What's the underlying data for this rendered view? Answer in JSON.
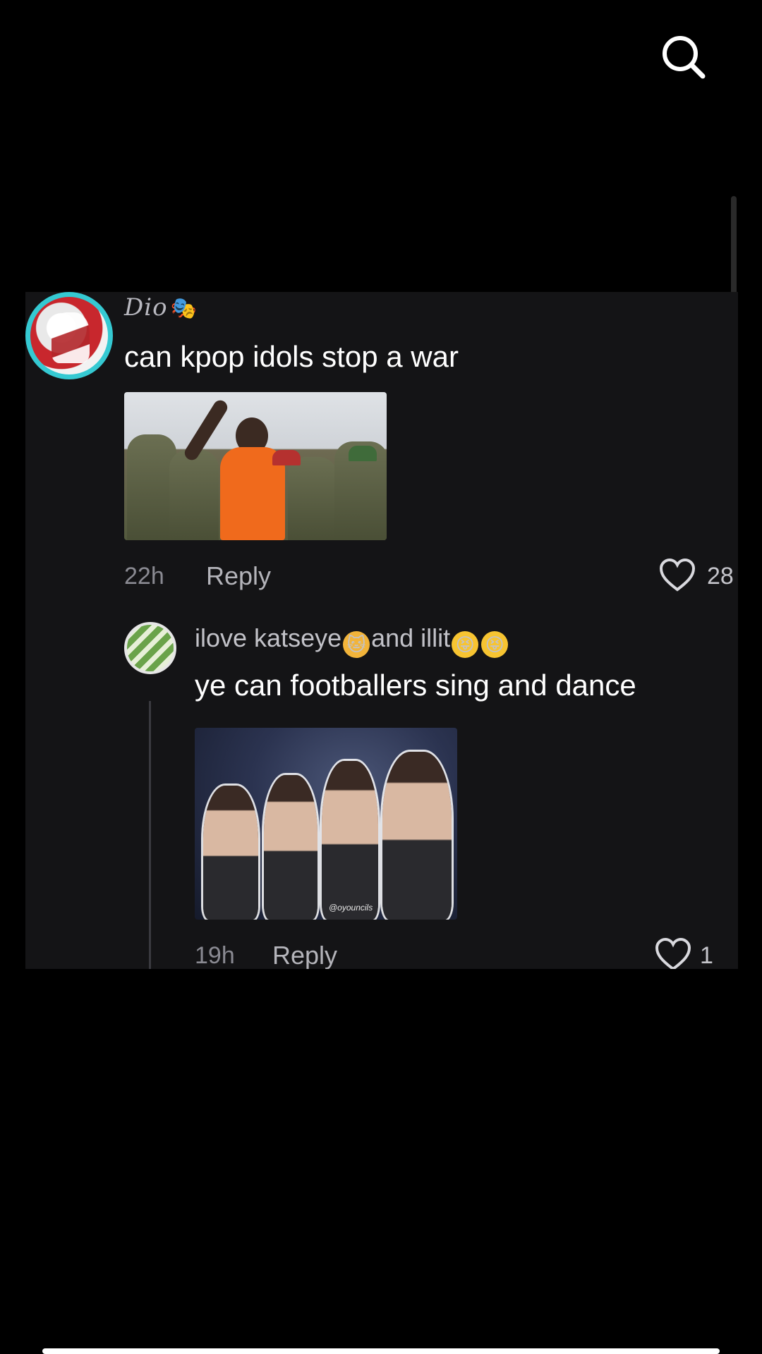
{
  "header": {
    "search_icon": "search-icon"
  },
  "comment": {
    "username": "Dio",
    "username_emoji": "🎭",
    "text": "can kpop idols stop a war",
    "time": "22h",
    "reply_label": "Reply",
    "like_count": "28",
    "like_icon": "heart-outline-icon"
  },
  "reply": {
    "username_part1": "ilove katseye",
    "emoji_cat": "🐱",
    "username_part2": "and illit",
    "emoji_face": "😝",
    "text": "ye can footballers sing and dance",
    "time": "19h",
    "reply_label": "Reply",
    "like_count": "1",
    "like_icon": "heart-outline-icon",
    "photo_watermark": "@oyouncils"
  },
  "colors": {
    "background": "#000000",
    "panel": "#141416",
    "text_primary": "#ffffff",
    "text_secondary": "#8a8a92",
    "avatar_ring": "#35c9d2"
  }
}
